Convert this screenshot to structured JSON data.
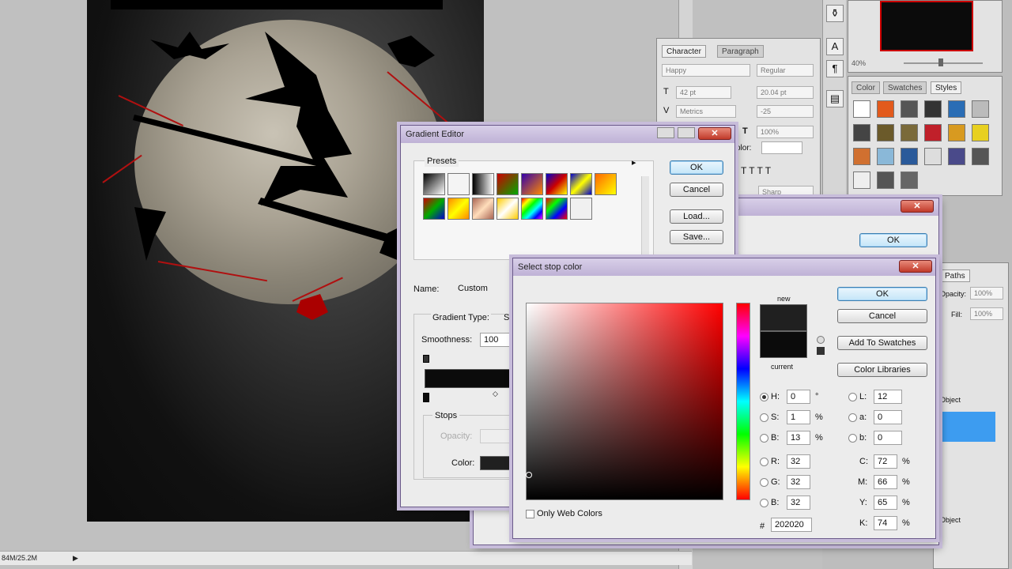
{
  "status": {
    "doc_size": "84M/25.2M"
  },
  "navigator": {
    "zoom": "40%"
  },
  "character_panel": {
    "tabs": [
      "Character",
      "Paragraph"
    ],
    "font_family": "Happy",
    "font_style": "Regular",
    "font_size": "42 pt",
    "leading": "20.04 pt",
    "kerning": "Metrics",
    "tracking": "-25",
    "scale": "100%",
    "color_label": "olor:",
    "antialias": "Sharp"
  },
  "styles_panel": {
    "tabs": [
      "Color",
      "Swatches",
      "Styles"
    ]
  },
  "layers_panel": {
    "tab": "Paths",
    "opacity_label": "Opacity:",
    "opacity": "100%",
    "fill_label": "Fill:",
    "fill": "100%",
    "layer1": "Object",
    "layer2": "Object"
  },
  "gradient_editor": {
    "title": "Gradient Editor",
    "presets_label": "Presets",
    "ok": "OK",
    "cancel": "Cancel",
    "load": "Load...",
    "save": "Save...",
    "name_label": "Name:",
    "name_value": "Custom",
    "type_label": "Gradient Type:",
    "type_value": "S",
    "smoothness_label": "Smoothness:",
    "smoothness_value": "100",
    "stops_label": "Stops",
    "opacity_label": "Opacity:",
    "color_label": "Color:"
  },
  "behind_dialog": {
    "ok": "OK"
  },
  "color_picker": {
    "title": "Select stop color",
    "ok": "OK",
    "cancel": "Cancel",
    "add_to_swatches": "Add To Swatches",
    "color_libraries": "Color Libraries",
    "new_label": "new",
    "current_label": "current",
    "new_color": "#202020",
    "current_color": "#0b0b0b",
    "only_web_colors": "Only Web Colors",
    "H": {
      "label": "H:",
      "value": "0",
      "unit": "°"
    },
    "S": {
      "label": "S:",
      "value": "1",
      "unit": "%"
    },
    "B": {
      "label": "B:",
      "value": "13",
      "unit": "%"
    },
    "R": {
      "label": "R:",
      "value": "32"
    },
    "G": {
      "label": "G:",
      "value": "32"
    },
    "Bl": {
      "label": "B:",
      "value": "32"
    },
    "L": {
      "label": "L:",
      "value": "12"
    },
    "a": {
      "label": "a:",
      "value": "0"
    },
    "b": {
      "label": "b:",
      "value": "0"
    },
    "C": {
      "label": "C:",
      "value": "72",
      "unit": "%"
    },
    "M": {
      "label": "M:",
      "value": "66",
      "unit": "%"
    },
    "Y": {
      "label": "Y:",
      "value": "65",
      "unit": "%"
    },
    "K": {
      "label": "K:",
      "value": "74",
      "unit": "%"
    },
    "hex_label": "#",
    "hex": "202020"
  }
}
